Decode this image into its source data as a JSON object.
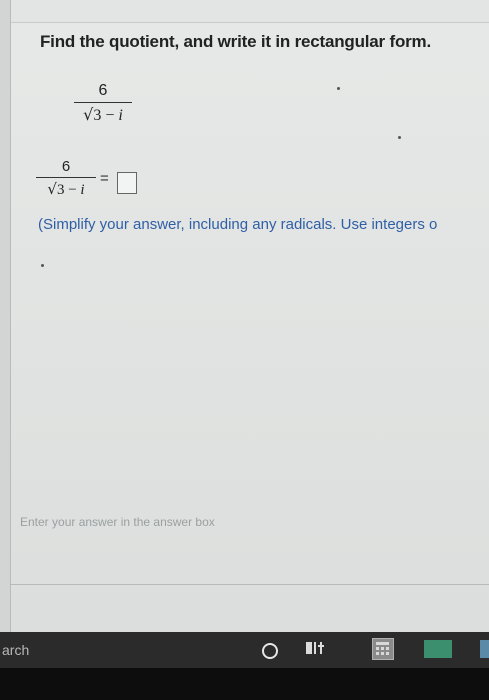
{
  "question": {
    "instructions": "Find the quotient, and write it in rectangular form.",
    "expression": {
      "numerator": "6",
      "radical_sign": "√",
      "radicand": "3",
      "operator": " − ",
      "imaginary_unit": "i"
    },
    "answer_equation": {
      "numerator": "6",
      "radical_sign": "√",
      "radicand": "3",
      "operator": " − ",
      "imaginary_unit": "i",
      "equals": "="
    },
    "hint": "(Simplify your answer, including any radicals. Use integers o"
  },
  "status_message": "Enter your answer in the answer box",
  "taskbar": {
    "search_label": "arch",
    "icons": [
      "cortana-circle-icon",
      "task-view-icon",
      "calculator-icon",
      "app-icon"
    ]
  },
  "colors": {
    "hint_text": "#2f5fa5",
    "taskbar": "#2b2b2b",
    "page_bg": "#e5e7e6"
  }
}
